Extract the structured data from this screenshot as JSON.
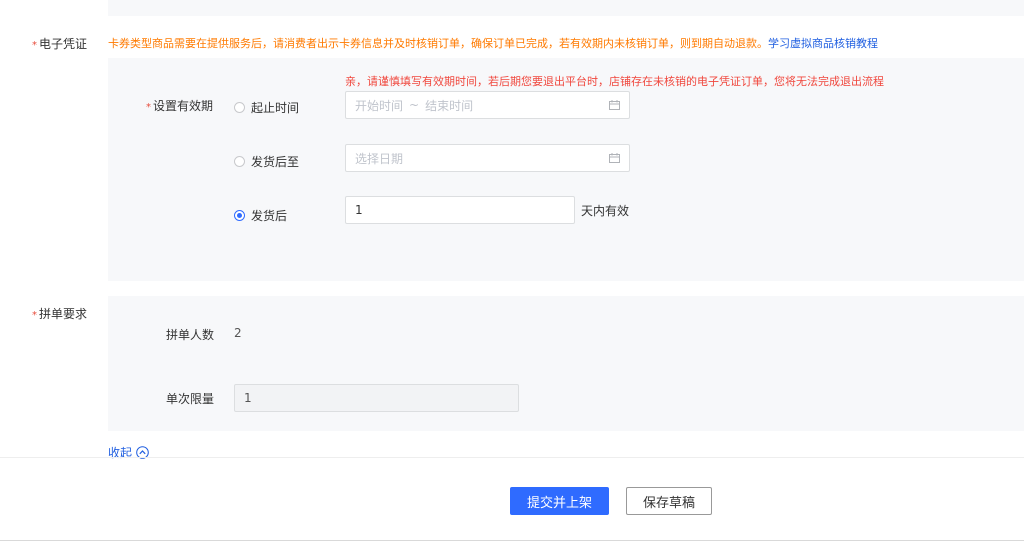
{
  "voucher": {
    "required_mark": "*",
    "label": "电子凭证",
    "notice": "卡券类型商品需要在提供服务后，请消费者出示卡券信息并及时核销订单，确保订单已完成，若有效期内未核销订单，则到期自动退款。",
    "tutorial_link": "学习虚拟商品核销教程"
  },
  "validity": {
    "warning": "亲，请谨慎填写有效期时间，若后期您要退出平台时，店铺存在未核销的电子凭证订单，您将无法完成退出流程",
    "required_mark": "*",
    "label": "设置有效期",
    "options": [
      {
        "label": "起止时间",
        "checked": false
      },
      {
        "label": "发货后至",
        "checked": false
      },
      {
        "label": "发货后",
        "checked": true
      }
    ],
    "range_start_placeholder": "开始时间",
    "range_separator": "~",
    "range_end_placeholder": "结束时间",
    "date_placeholder": "选择日期",
    "days_value": "1",
    "days_suffix": "天内有效"
  },
  "group": {
    "required_mark": "*",
    "label": "拼单要求",
    "people_label": "拼单人数",
    "people_value": "2",
    "limit_label": "单次限量",
    "limit_value": "1",
    "collapse_label": "收起"
  },
  "footer": {
    "submit_label": "提交并上架",
    "draft_label": "保存草稿"
  }
}
